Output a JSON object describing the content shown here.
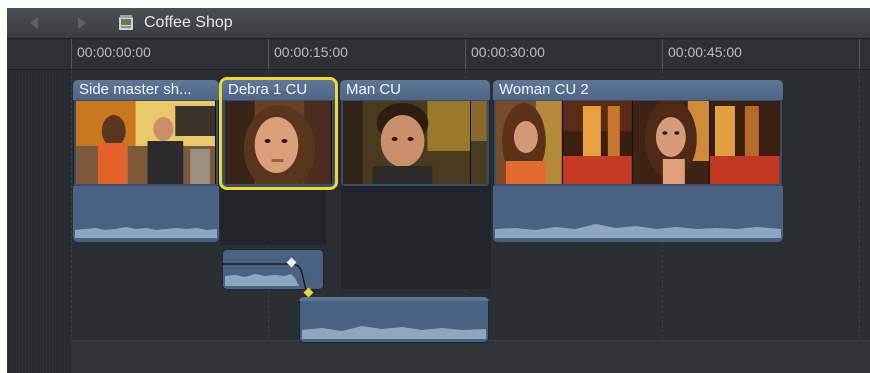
{
  "window": {
    "project_title": "Coffee Shop"
  },
  "navigation": {
    "back_icon": "back-arrow-icon",
    "forward_icon": "forward-arrow-icon",
    "project_icon": "project-icon"
  },
  "ruler": {
    "timecodes": [
      "00:00:00:00",
      "00:00:15:00",
      "00:00:30:00",
      "00:00:45:00"
    ]
  },
  "clips": [
    {
      "title": "Side master sh...",
      "selected": false
    },
    {
      "title": "Debra 1 CU",
      "selected": true
    },
    {
      "title": "Man CU",
      "selected": false
    },
    {
      "title": "Woman CU 2",
      "selected": false
    }
  ],
  "audio_clips": [
    {
      "name": "connected-audio-clip",
      "selected": true,
      "has_keyframes": true
    },
    {
      "name": "lower-audio-clip",
      "selected": false,
      "has_keyframes": false
    }
  ],
  "colors": {
    "selection": "#e8da3c",
    "clip_header": "#5f7797",
    "clip_body": "#4a6282",
    "background": "#262a2f"
  }
}
